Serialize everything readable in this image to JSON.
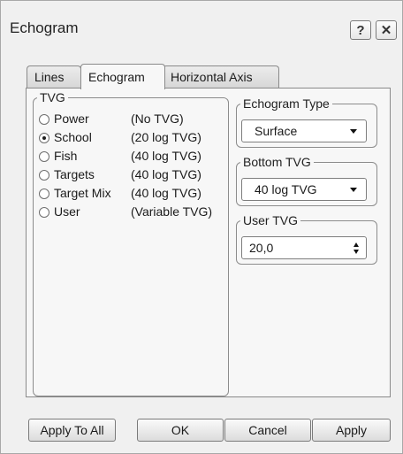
{
  "window": {
    "title": "Echogram",
    "help_glyph": "?",
    "close_glyph": "✕"
  },
  "tabs": [
    {
      "label": "Lines",
      "active": false
    },
    {
      "label": "Echogram",
      "active": true
    },
    {
      "label": "Horizontal Axis",
      "active": false
    }
  ],
  "tvg": {
    "legend": "TVG",
    "options": [
      {
        "label": "Power",
        "desc": "(No TVG)",
        "selected": false
      },
      {
        "label": "School",
        "desc": "(20 log TVG)",
        "selected": true
      },
      {
        "label": "Fish",
        "desc": "(40 log TVG)",
        "selected": false
      },
      {
        "label": "Targets",
        "desc": "(40 log TVG)",
        "selected": false
      },
      {
        "label": "Target Mix",
        "desc": "(40 log TVG)",
        "selected": false
      },
      {
        "label": "User",
        "desc": "(Variable TVG)",
        "selected": false
      }
    ]
  },
  "echogram_type": {
    "legend": "Echogram Type",
    "value": "Surface"
  },
  "bottom_tvg": {
    "legend": "Bottom TVG",
    "value": "40 log TVG"
  },
  "user_tvg": {
    "legend": "User TVG",
    "value": "20,0"
  },
  "buttons": {
    "apply_to_all": "Apply To All",
    "ok": "OK",
    "cancel": "Cancel",
    "apply": "Apply"
  }
}
